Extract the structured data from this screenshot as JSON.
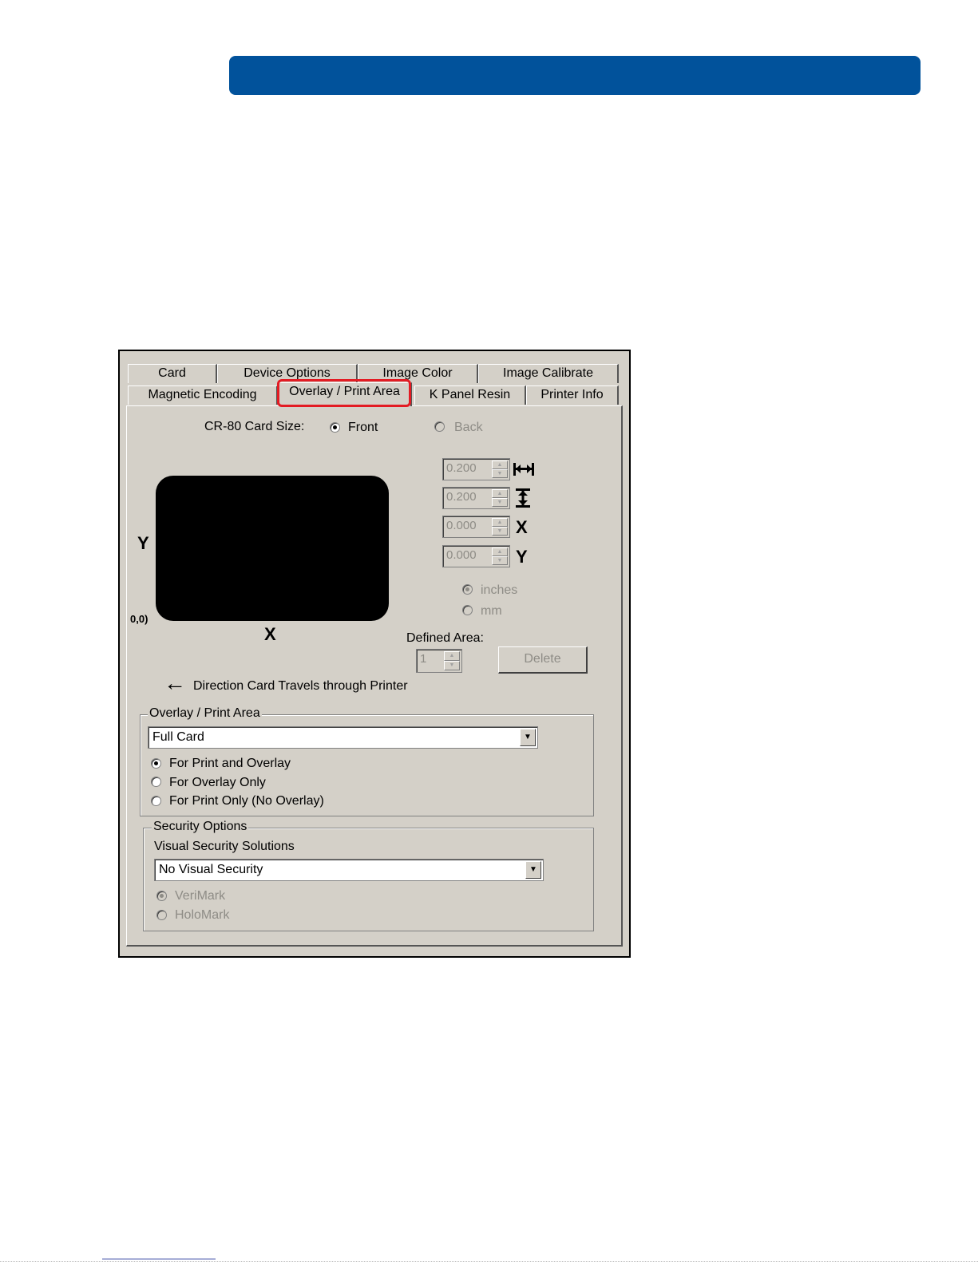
{
  "tabs": {
    "row1": [
      "Card",
      "Device Options",
      "Image Color",
      "Image Calibrate"
    ],
    "row2": [
      "Magnetic Encoding",
      "Overlay / Print Area",
      "K Panel Resin",
      "Printer Info"
    ],
    "active": "Overlay / Print Area"
  },
  "card_size": {
    "label": "CR-80 Card Size:",
    "front": "Front",
    "back": "Back",
    "selected": "Front"
  },
  "preview": {
    "y_label": "Y",
    "x_label": "X",
    "origin_label": "0,0)",
    "direction_arrow": "←",
    "direction_text": "Direction Card Travels through Printer"
  },
  "dimensions": {
    "width": "0.200",
    "height": "0.200",
    "x": "0.000",
    "y": "0.000",
    "x_icon_label": "X",
    "y_icon_label": "Y",
    "width_icon": "width-arrows-icon",
    "height_icon": "height-arrows-icon"
  },
  "units": {
    "inches": "inches",
    "mm": "mm",
    "selected": "inches"
  },
  "defined_area": {
    "label": "Defined Area:",
    "value": "1",
    "delete_label": "Delete"
  },
  "overlay_group": {
    "title": "Overlay / Print Area",
    "selected_value": "Full Card",
    "options": [
      "For Print and Overlay",
      "For Overlay Only",
      "For Print Only (No Overlay)"
    ],
    "selected_option": "For Print and Overlay"
  },
  "security_group": {
    "title": "Security Options",
    "subtitle": "Visual Security Solutions",
    "selected_value": "No Visual Security",
    "options": [
      "VeriMark",
      "HoloMark"
    ],
    "selected_option": "VeriMark"
  },
  "colors": {
    "header_bar": "#01529b",
    "dialog_bg": "#d4d0c8",
    "highlight": "#e31b23"
  }
}
